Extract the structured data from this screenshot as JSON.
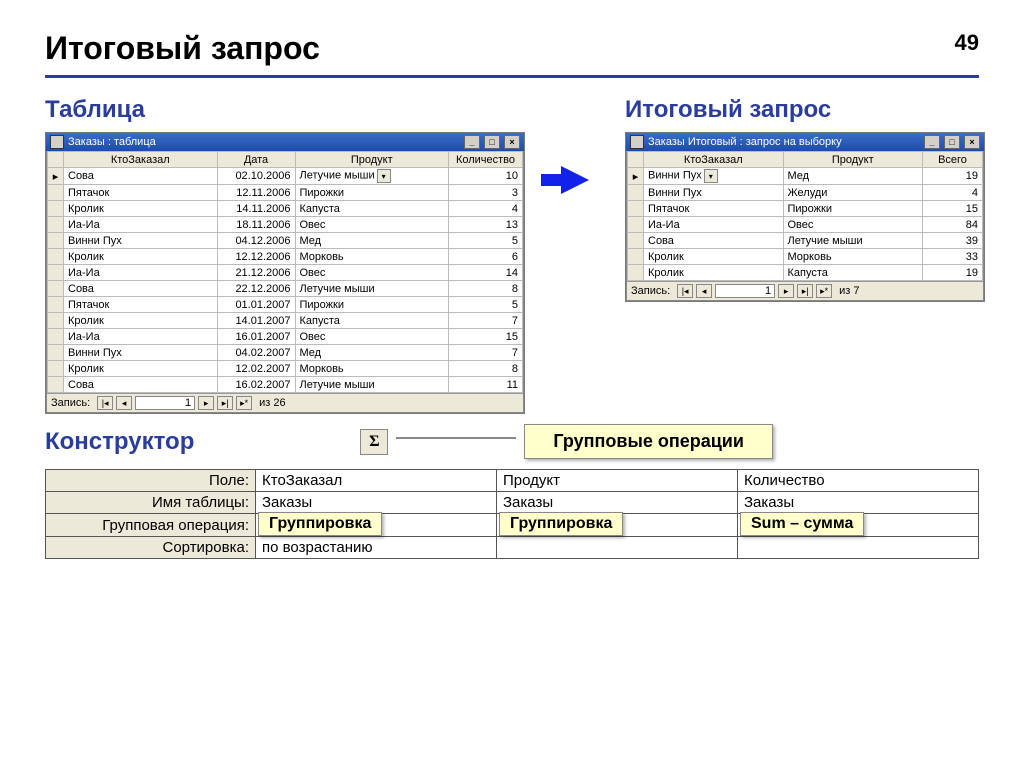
{
  "page_number": "49",
  "title": "Итоговый запрос",
  "table_section": {
    "heading": "Таблица",
    "window_title": "Заказы : таблица",
    "columns": [
      "КтоЗаказал",
      "Дата",
      "Продукт",
      "Количество"
    ],
    "rows": [
      [
        "Сова",
        "02.10.2006",
        "Летучие мыши",
        "10"
      ],
      [
        "Пятачок",
        "12.11.2006",
        "Пирожки",
        "3"
      ],
      [
        "Кролик",
        "14.11.2006",
        "Капуста",
        "4"
      ],
      [
        "Иа-Иа",
        "18.11.2006",
        "Овес",
        "13"
      ],
      [
        "Винни Пух",
        "04.12.2006",
        "Мед",
        "5"
      ],
      [
        "Кролик",
        "12.12.2006",
        "Морковь",
        "6"
      ],
      [
        "Иа-Иа",
        "21.12.2006",
        "Овес",
        "14"
      ],
      [
        "Сова",
        "22.12.2006",
        "Летучие мыши",
        "8"
      ],
      [
        "Пятачок",
        "01.01.2007",
        "Пирожки",
        "5"
      ],
      [
        "Кролик",
        "14.01.2007",
        "Капуста",
        "7"
      ],
      [
        "Иа-Иа",
        "16.01.2007",
        "Овес",
        "15"
      ],
      [
        "Винни Пух",
        "04.02.2007",
        "Мед",
        "7"
      ],
      [
        "Кролик",
        "12.02.2007",
        "Морковь",
        "8"
      ],
      [
        "Сова",
        "16.02.2007",
        "Летучие мыши",
        "11"
      ]
    ],
    "record_nav": {
      "label": "Запись:",
      "current": "1",
      "count": "из 26"
    }
  },
  "query_section": {
    "heading": "Итоговый запрос",
    "window_title": "Заказы Итоговый : запрос на выборку",
    "columns": [
      "КтоЗаказал",
      "Продукт",
      "Всего"
    ],
    "rows": [
      [
        "Винни Пух",
        "Мед",
        "19"
      ],
      [
        "Винни Пух",
        "Желуди",
        "4"
      ],
      [
        "Пятачок",
        "Пирожки",
        "15"
      ],
      [
        "Иа-Иа",
        "Овес",
        "84"
      ],
      [
        "Сова",
        "Летучие мыши",
        "39"
      ],
      [
        "Кролик",
        "Морковь",
        "33"
      ],
      [
        "Кролик",
        "Капуста",
        "19"
      ]
    ],
    "record_nav": {
      "label": "Запись:",
      "current": "1",
      "count": "из 7"
    }
  },
  "designer_section": {
    "heading": "Конструктор",
    "sigma": "Σ",
    "callout": "Групповые операции",
    "row_labels": [
      "Поле:",
      "Имя таблицы:",
      "Групповая операция:",
      "Сортировка:"
    ],
    "cols": [
      {
        "field": "КтоЗаказал",
        "table": "Заказы",
        "group": "Группировка",
        "sort": "по возрастанию"
      },
      {
        "field": "Продукт",
        "table": "Заказы",
        "group": "Группировка",
        "sort": ""
      },
      {
        "field": "Количество",
        "table": "Заказы",
        "group": "Sum – сумма",
        "sort": ""
      }
    ]
  }
}
